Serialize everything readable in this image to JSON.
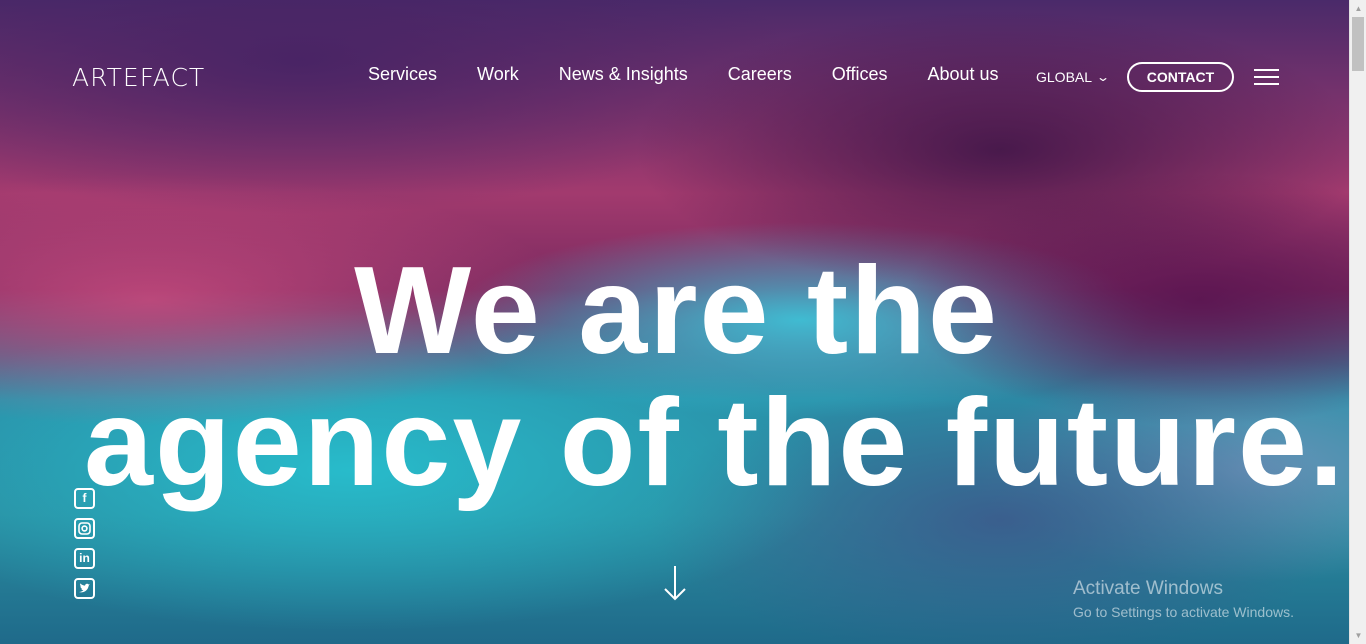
{
  "brand": {
    "logo": "ARTEFACT"
  },
  "nav": {
    "items": [
      "Services",
      "Work",
      "News & Insights",
      "Careers",
      "Offices",
      "About us"
    ],
    "region": "GLOBAL",
    "contact": "CONTACT"
  },
  "hero": {
    "line1": "We are the",
    "line2": "agency of the future."
  },
  "social": {
    "icons": [
      "facebook-icon",
      "instagram-icon",
      "linkedin-icon",
      "twitter-icon"
    ]
  },
  "watermark": {
    "title": "Activate Windows",
    "subtitle": "Go to Settings to activate Windows."
  },
  "colors": {
    "text": "#ffffff",
    "scrollbar_track": "#f0f0f0",
    "scrollbar_thumb": "#c1c1c1"
  }
}
